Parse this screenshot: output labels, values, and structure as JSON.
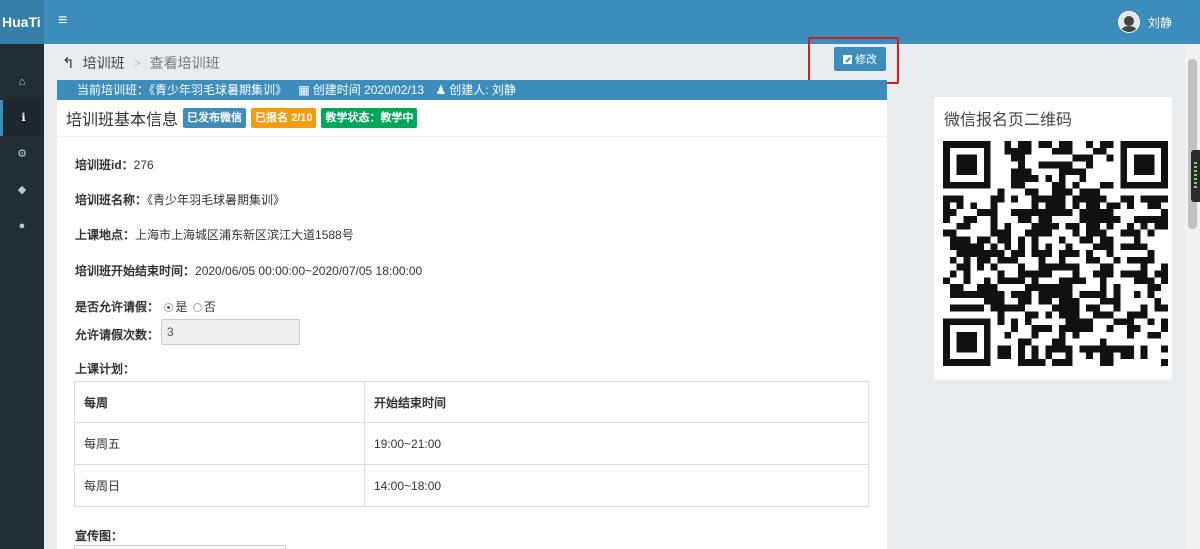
{
  "app": {
    "brand": "HuaTi",
    "menu_glyph": "≡"
  },
  "user": {
    "name": "刘静"
  },
  "sidebar": {
    "items": [
      {
        "icon": "home-icon",
        "glyph": "⌂"
      },
      {
        "icon": "info-icon",
        "glyph": "ℹ"
      },
      {
        "icon": "cogs-icon",
        "glyph": "⚙"
      },
      {
        "icon": "tags-icon",
        "glyph": "◆"
      },
      {
        "icon": "comments-icon",
        "glyph": "●"
      }
    ]
  },
  "breadcrumb": {
    "back_glyph": "↰",
    "parent": "培训班",
    "separator": ">",
    "current": "查看培训班"
  },
  "toolbar": {
    "edit_label": "修改"
  },
  "infobar": {
    "current_label": "当前培训班：《青少年羽毛球暑期集训》",
    "created_time": "创建时间 2020/02/13",
    "creator": "创建人: 刘静"
  },
  "box": {
    "title": "培训班基本信息",
    "badges": {
      "wechat": "已发布微信",
      "enrolled": "已报名 2/10",
      "status": "教学状态：教学中"
    }
  },
  "fields": {
    "id_label": "培训班id：",
    "id_value": "276",
    "name_label": "培训班名称：",
    "name_value": "《青少年羽毛球暑期集训》",
    "location_label": "上课地点：",
    "location_value": "上海市上海城区浦东新区滨江大道1588号",
    "time_label": "培训班开始结束时间：",
    "time_value": "2020/06/05 00:00:00~2020/07/05 18:00:00",
    "leave_label": "是否允许请假：",
    "leave_yes": "是",
    "leave_no": "否",
    "leave_count_label": "允许请假次数：",
    "leave_count_value": "3",
    "plan_label": "上课计划：",
    "promo_label": "宣传图："
  },
  "schedule": {
    "headers": [
      "每周",
      "开始结束时间"
    ],
    "rows": [
      [
        "每周五",
        "19:00~21:00"
      ],
      [
        "每周日",
        "14:00~18:00"
      ]
    ]
  },
  "qr_panel": {
    "title": "微信报名页二维码"
  }
}
